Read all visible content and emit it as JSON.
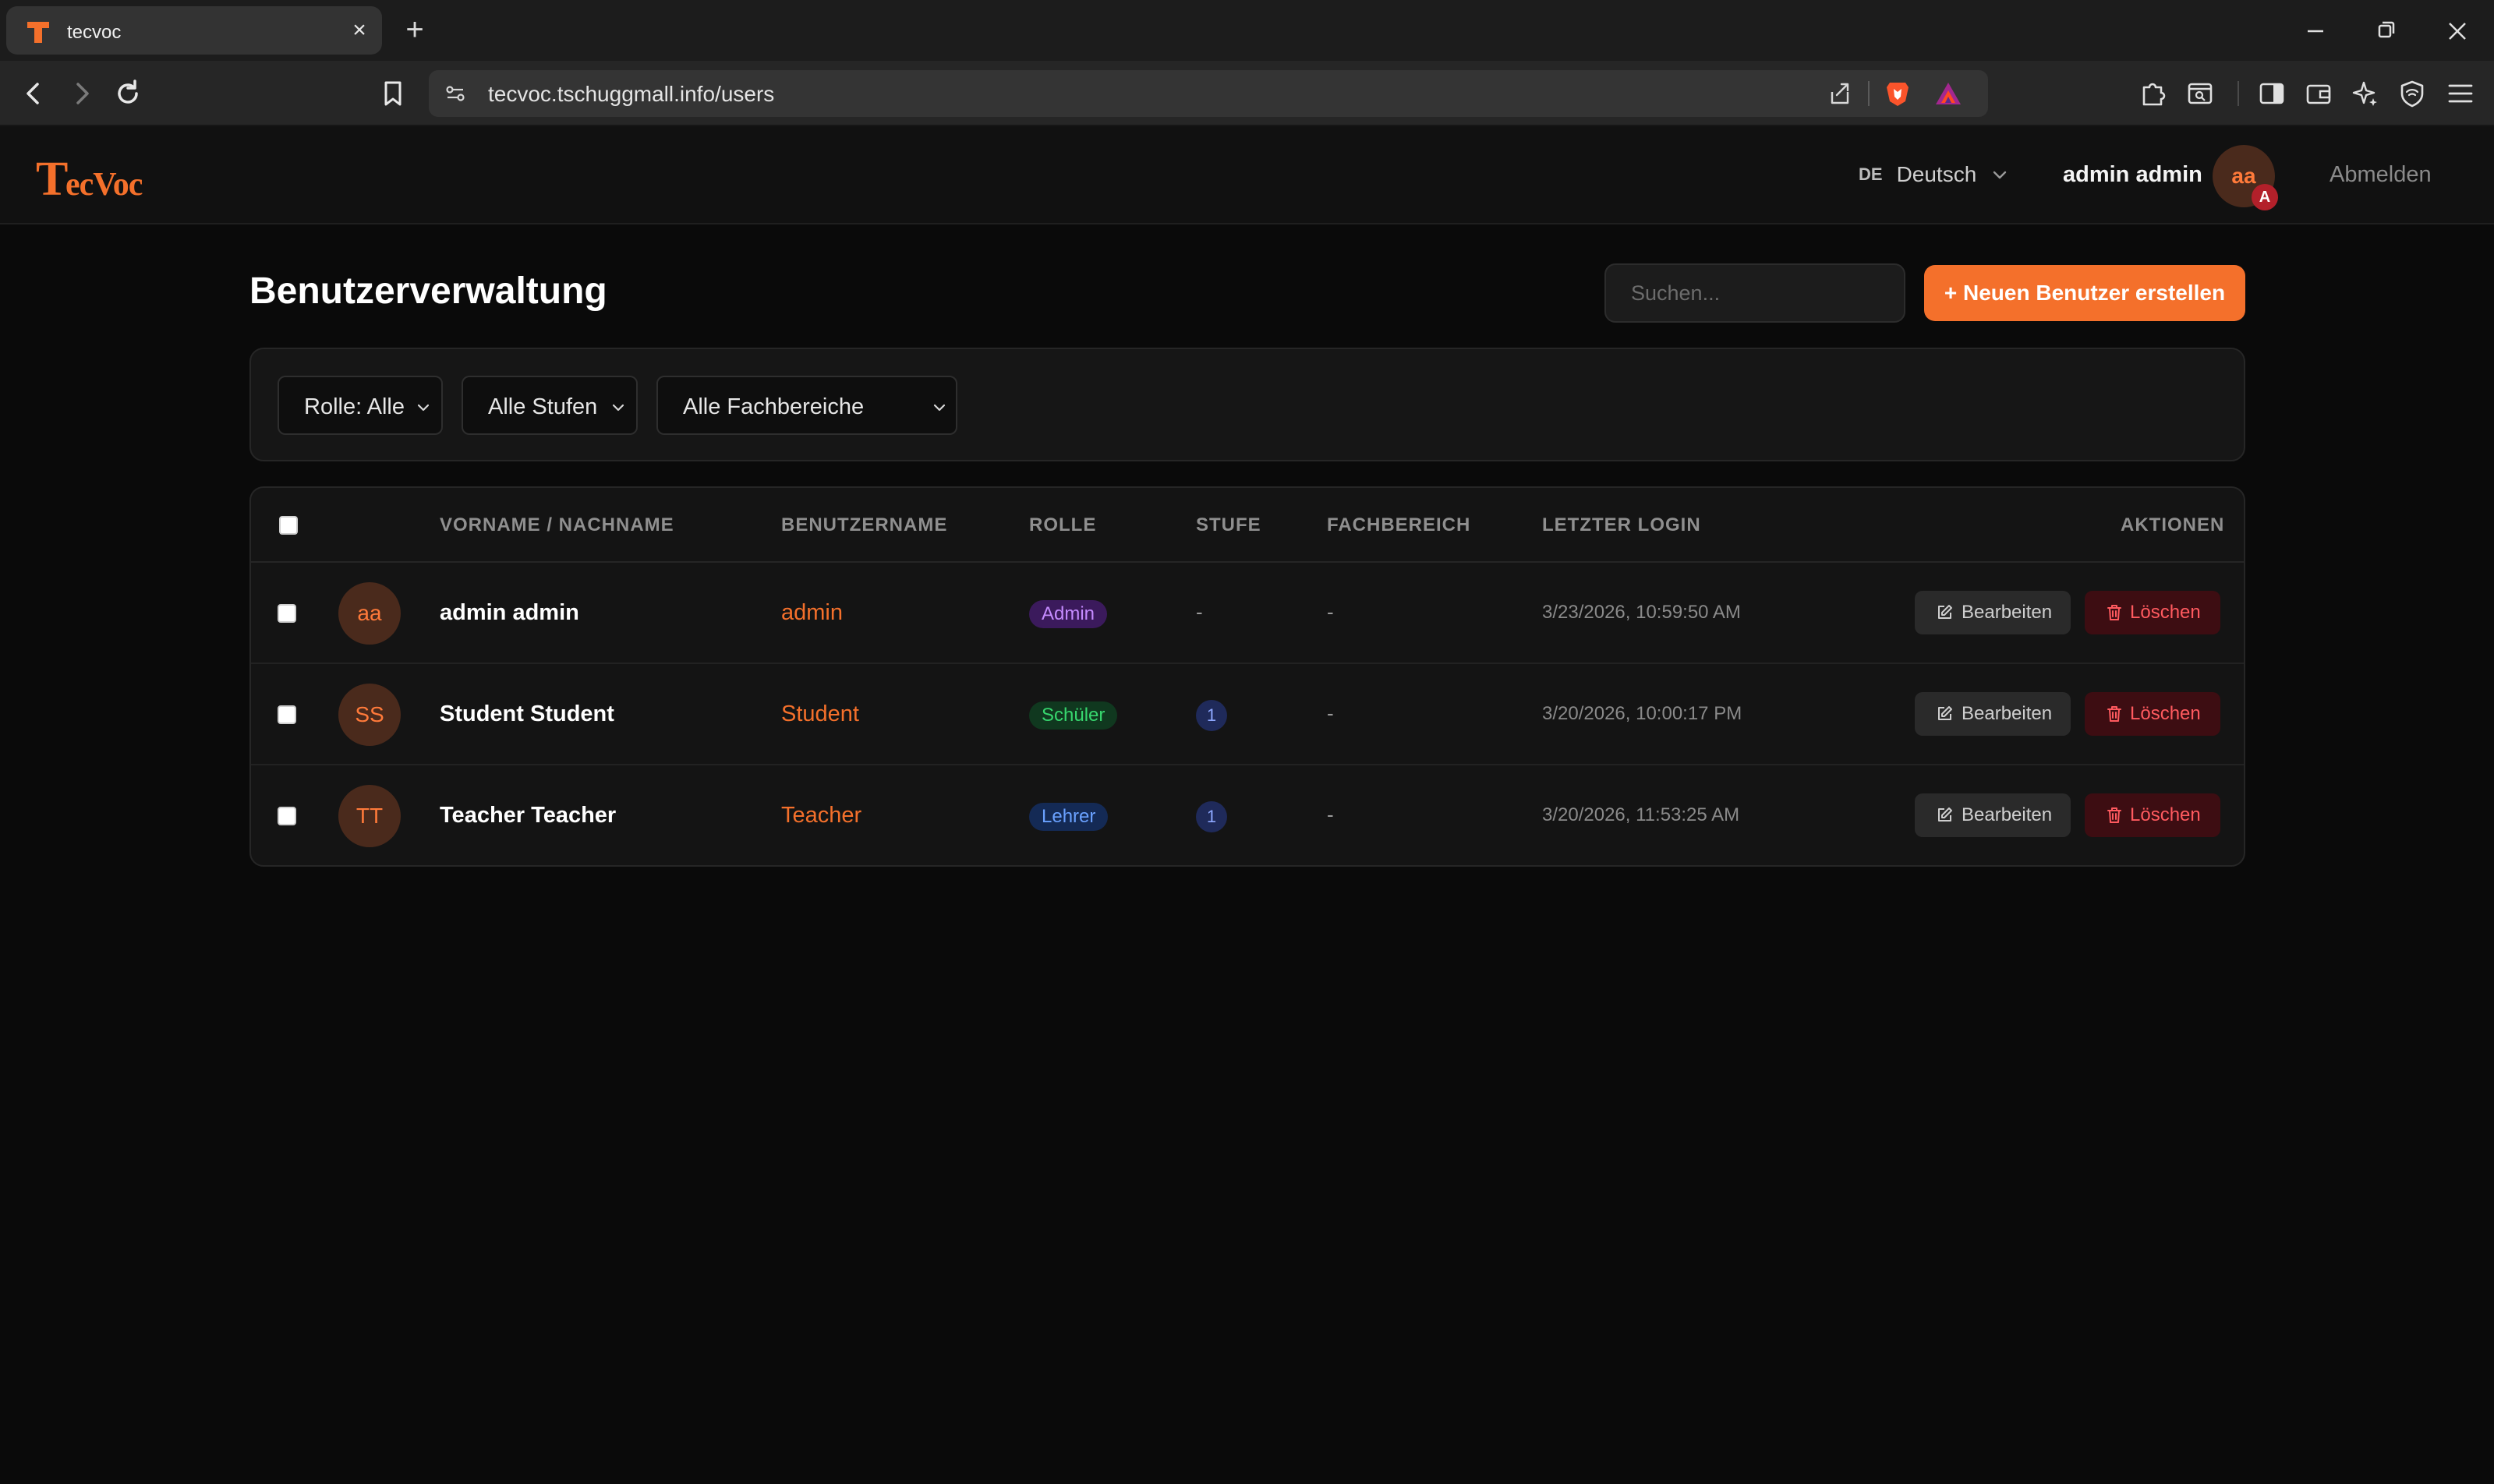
{
  "browser": {
    "tab_title": "tecvoc",
    "new_tab_symbol": "+",
    "close_symbol": "×",
    "url": "tecvoc.tschuggmall.info/users"
  },
  "header": {
    "lang_code": "DE",
    "lang_name": "Deutsch",
    "user_name": "admin admin",
    "avatar_initials": "aa",
    "avatar_badge": "A",
    "logout_label": "Abmelden"
  },
  "page": {
    "title": "Benutzerverwaltung",
    "search_placeholder": "Suchen...",
    "create_button_label": "+ Neuen Benutzer erstellen"
  },
  "filters": {
    "role": "Rolle: Alle",
    "levels": "Alle Stufen",
    "departments": "Alle Fachbereiche"
  },
  "table": {
    "columns": [
      "VORNAME / NACHNAME",
      "BENUTZERNAME",
      "ROLLE",
      "STUFE",
      "FACHBEREICH",
      "LETZTER LOGIN",
      "AKTIONEN"
    ],
    "edit_label": "Bearbeiten",
    "delete_label": "Löschen",
    "rows": [
      {
        "initials": "aa",
        "name": "admin admin",
        "username": "admin",
        "role": "Admin",
        "role_color": "#c58bff",
        "level": "-",
        "department": "-",
        "last_login": "3/23/2026, 10:59:50 AM"
      },
      {
        "initials": "SS",
        "name": "Student Student",
        "username": "Student",
        "role": "Schüler",
        "role_color": "#37d66e",
        "level": "1",
        "department": "-",
        "last_login": "3/20/2026, 10:00:17 PM"
      },
      {
        "initials": "TT",
        "name": "Teacher Teacher",
        "username": "Teacher",
        "role": "Lehrer",
        "role_color": "#6aa1ff",
        "level": "1",
        "department": "-",
        "last_login": "3/20/2026, 11:53:25 AM"
      }
    ]
  },
  "colors": {
    "accent": "#f4702b",
    "danger": "#ff5a5f",
    "background": "#0a0a0a"
  },
  "logo_text": "TecVoc",
  "icons": [
    "back-icon",
    "forward-icon",
    "reload-icon",
    "bookmark-icon",
    "site-settings-icon",
    "share-icon",
    "brave-shield-icon",
    "brave-rewards-icon",
    "extensions-icon",
    "reader-mode-icon",
    "sidebar-icon",
    "wallet-icon",
    "leo-ai-icon",
    "vpn-icon",
    "menu-icon",
    "edit-icon",
    "trash-icon",
    "chevron-down-icon"
  ]
}
